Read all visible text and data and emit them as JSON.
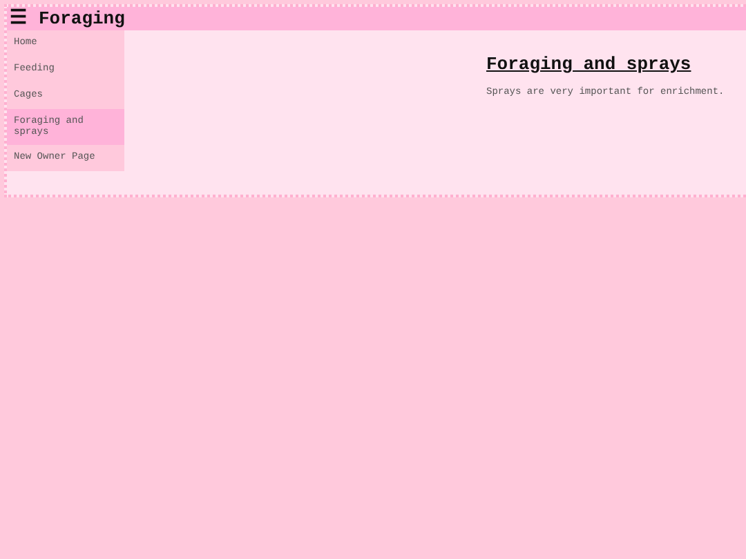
{
  "header": {
    "menu_icon": "☰",
    "title": "Foraging"
  },
  "sidebar": {
    "items": [
      {
        "label": "Home",
        "selected": false
      },
      {
        "label": "Feeding",
        "selected": false
      },
      {
        "label": "Cages",
        "selected": false
      },
      {
        "label": "Foraging and sprays",
        "selected": true
      },
      {
        "label": "New Owner Page",
        "selected": false
      }
    ]
  },
  "content": {
    "heading": "Foraging and sprays",
    "text": "Sprays are very important for enrichment."
  }
}
